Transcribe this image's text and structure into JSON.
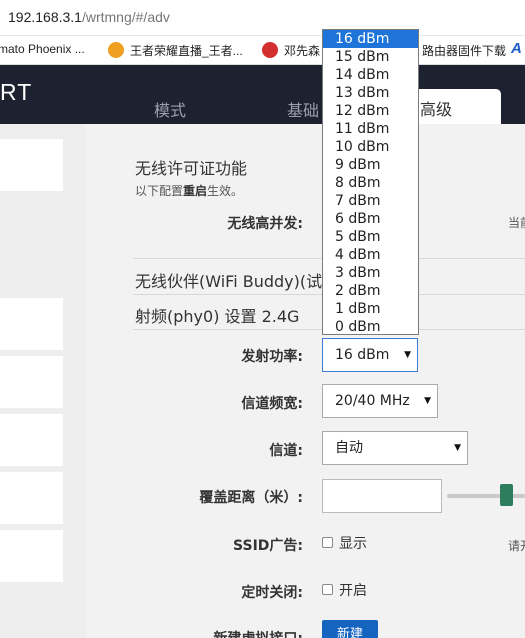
{
  "browser": {
    "url_host": "192.168.3.1",
    "url_path": "/wrtmng/#/adv",
    "bookmarks": [
      "mato Phoenix ...",
      "王者荣耀直播_王者...",
      "邓先森",
      "路由器固件下载"
    ]
  },
  "header": {
    "brand": "RT",
    "tabs": [
      "模式",
      "基础",
      "高级"
    ],
    "active_tab": "高级"
  },
  "wireless_license": {
    "title": "无线许可证功能",
    "note_prefix": "以下配置",
    "note_emphasis": "重启",
    "note_suffix": "生效。",
    "high_concurrency_label": "无线高并发:",
    "high_concurrency_hint": "当前"
  },
  "wifi_buddy": {
    "title": "无线伙伴(WiFi Buddy)(试"
  },
  "radio": {
    "title": "射频(phy0) 设置 2.4G",
    "tx_power_label": "发射功率:",
    "tx_power_value": "16 dBm",
    "tx_power_options": [
      "16 dBm",
      "15 dBm",
      "14 dBm",
      "13 dBm",
      "12 dBm",
      "11 dBm",
      "10 dBm",
      "9 dBm",
      "8 dBm",
      "7 dBm",
      "6 dBm",
      "5 dBm",
      "4 dBm",
      "3 dBm",
      "2 dBm",
      "1 dBm",
      "0 dBm"
    ],
    "bandwidth_label": "信道频宽:",
    "bandwidth_value": "20/40 MHz",
    "channel_label": "信道:",
    "channel_value": "自动",
    "coverage_label": "覆盖距离（米）:",
    "coverage_value": "",
    "ssid_broadcast_label": "SSID广告:",
    "ssid_broadcast_option": "显示",
    "ssid_hint": "请开",
    "timed_off_label": "定时关闭:",
    "timed_off_option": "开启",
    "new_vif_label": "新建虚拟接口:",
    "new_button": "新建"
  },
  "colors": {
    "header_bg": "#1d2231",
    "selection": "#1e74d8",
    "slider_thumb": "#2e7d5e",
    "button": "#1565c0"
  }
}
